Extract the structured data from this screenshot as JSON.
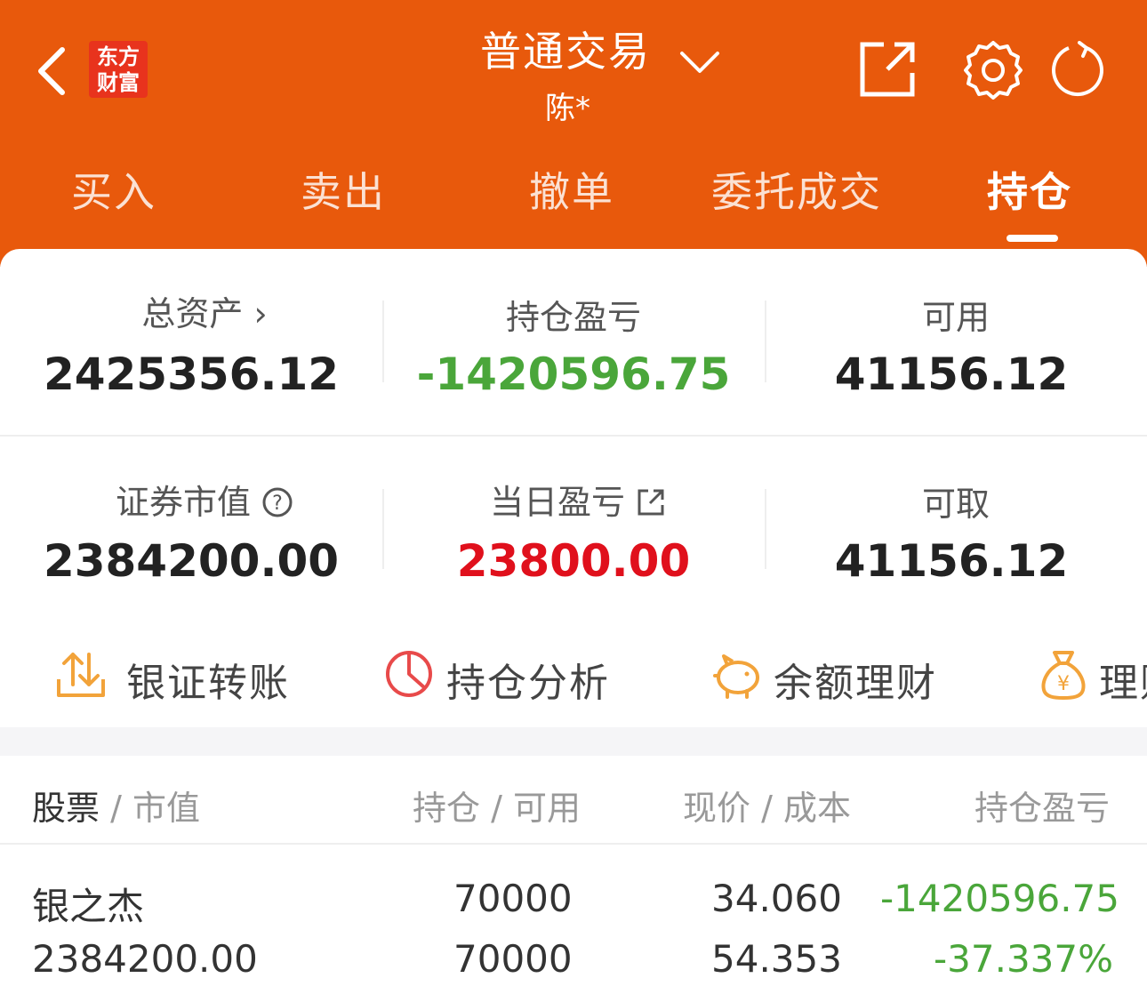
{
  "header": {
    "logo_line1": "东方",
    "logo_line2": "财富",
    "title": "普通交易",
    "account": "陈*"
  },
  "tabs": [
    {
      "label": "买入"
    },
    {
      "label": "卖出"
    },
    {
      "label": "撤单"
    },
    {
      "label": "委托成交"
    },
    {
      "label": "持仓",
      "active": true
    }
  ],
  "summary": {
    "total_assets_label": "总资产",
    "total_assets": "2425356.12",
    "position_pnl_label": "持仓盈亏",
    "position_pnl": "-1420596.75",
    "available_label": "可用",
    "available": "41156.12",
    "market_value_label": "证券市值",
    "market_value": "2384200.00",
    "daily_pnl_label": "当日盈亏",
    "daily_pnl": "23800.00",
    "withdrawable_label": "可取",
    "withdrawable": "41156.12"
  },
  "quick_actions": [
    {
      "label": "银证转账",
      "icon": "transfer-icon"
    },
    {
      "label": "持仓分析",
      "icon": "pie-chart-icon"
    },
    {
      "label": "余额理财",
      "icon": "piggy-bank-icon"
    },
    {
      "label": "理财",
      "icon": "money-bag-icon"
    }
  ],
  "table": {
    "headers": {
      "stock": "股票",
      "market_value": "市值",
      "position": "持仓",
      "available": "可用",
      "price": "现价",
      "cost": "成本",
      "pnl": "持仓盈亏"
    },
    "rows": [
      {
        "name": "银之杰",
        "market_value": "2384200.00",
        "position": "70000",
        "available": "70000",
        "price": "34.060",
        "cost": "54.353",
        "pnl": "-1420596.75",
        "pnl_pct": "-37.337%"
      }
    ]
  },
  "colors": {
    "brand_orange": "#e8590c",
    "gain_red": "#e0101c",
    "loss_green": "#4aa63a"
  }
}
